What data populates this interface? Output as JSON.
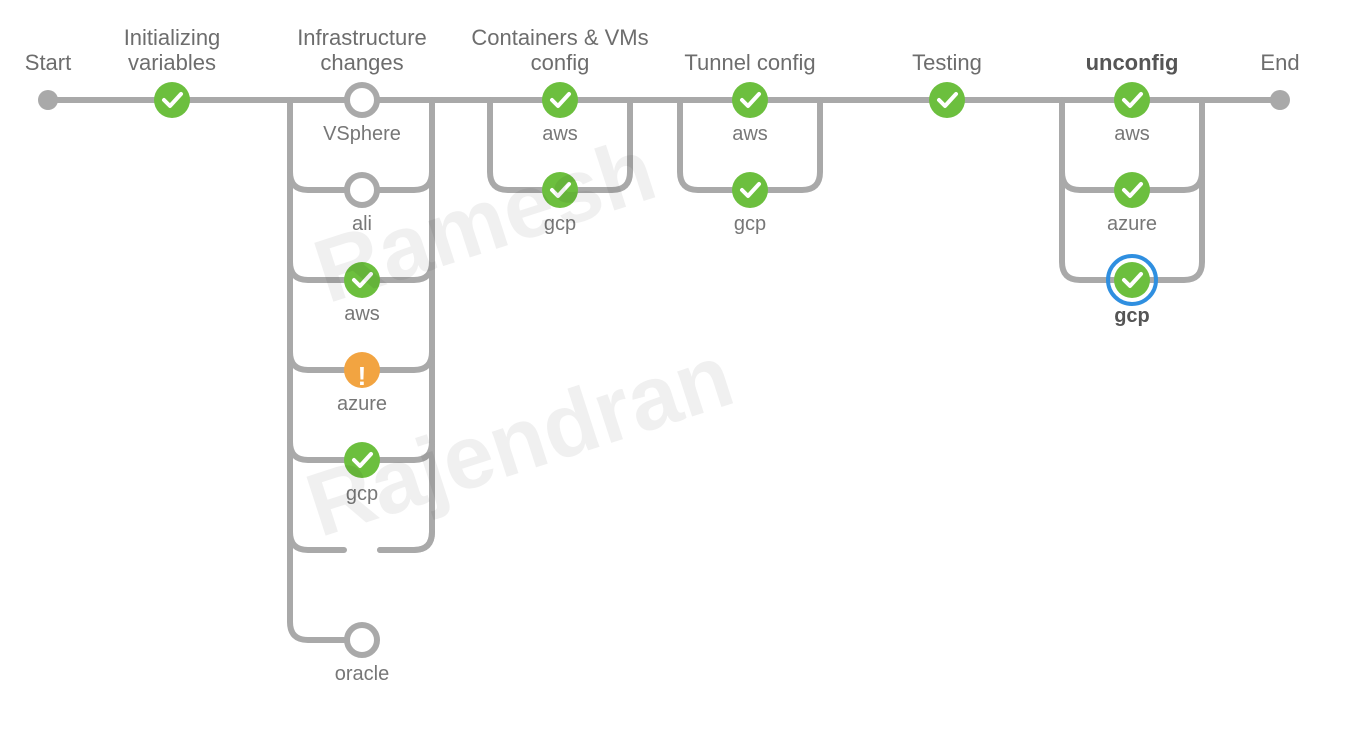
{
  "watermark": {
    "line1": "Ramesh",
    "line2": "Rajendran"
  },
  "colors": {
    "connector": "#a9a9a9",
    "success": "#6cbf3e",
    "warn": "#f2a441",
    "selected": "#2f8fe0",
    "text": "#6d6d6d"
  },
  "nodes": {
    "start": {
      "label": "Start",
      "status": "endpoint"
    },
    "init_vars": {
      "label_line1": "Initializing",
      "label_line2": "variables",
      "status": "success"
    },
    "infra": {
      "label_line1": "Infrastructure",
      "label_line2": "changes",
      "subs": [
        {
          "label": "VSphere",
          "status": "empty"
        },
        {
          "label": "ali",
          "status": "empty"
        },
        {
          "label": "aws",
          "status": "success"
        },
        {
          "label": "azure",
          "status": "warn"
        },
        {
          "label": "gcp",
          "status": "success"
        },
        {
          "label": "oracle",
          "status": "empty"
        }
      ]
    },
    "containers": {
      "label_line1": "Containers & VMs",
      "label_line2": "config",
      "subs": [
        {
          "label": "aws",
          "status": "success"
        },
        {
          "label": "gcp",
          "status": "success"
        }
      ]
    },
    "tunnel": {
      "label_line1": "Tunnel config",
      "subs": [
        {
          "label": "aws",
          "status": "success"
        },
        {
          "label": "gcp",
          "status": "success"
        }
      ]
    },
    "testing": {
      "label_line1": "Testing",
      "status": "success"
    },
    "unconfig": {
      "label_line1": "unconfig",
      "bold": true,
      "subs": [
        {
          "label": "aws",
          "status": "success"
        },
        {
          "label": "azure",
          "status": "success"
        },
        {
          "label": "gcp",
          "status": "success",
          "selected": true,
          "bold": true
        }
      ]
    },
    "end": {
      "label": "End",
      "status": "endpoint"
    }
  }
}
